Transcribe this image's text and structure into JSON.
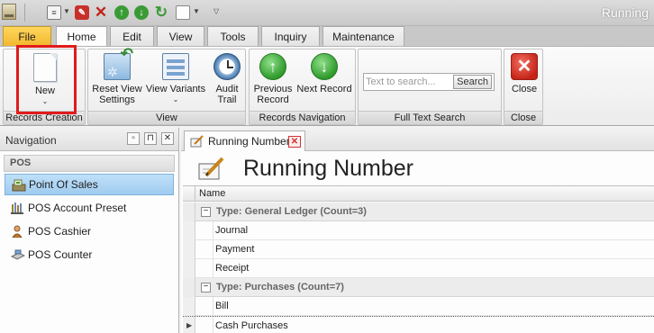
{
  "window": {
    "title": "Running"
  },
  "quick_access": [
    {
      "icon": "document-icon"
    },
    {
      "icon": "pdf-icon"
    },
    {
      "icon": "delete-icon"
    },
    {
      "icon": "move-up-icon"
    },
    {
      "icon": "move-down-icon"
    },
    {
      "icon": "refresh-icon"
    },
    {
      "icon": "new-page-icon"
    },
    {
      "icon": "customize-icon"
    }
  ],
  "ribbon": {
    "tabs": [
      "File",
      "Home",
      "Edit",
      "View",
      "Tools",
      "Inquiry",
      "Maintenance"
    ],
    "active_tab": "Home",
    "groups": {
      "records_creation": {
        "caption": "Records Creation",
        "new_label": "New"
      },
      "view": {
        "caption": "View",
        "reset_label": "Reset View\nSettings",
        "variants_label": "View Variants",
        "audit_label": "Audit\nTrail"
      },
      "navigation": {
        "caption": "Records Navigation",
        "previous_label": "Previous\nRecord",
        "next_label": "Next Record"
      },
      "search": {
        "caption": "Full Text Search",
        "placeholder": "Text to search...",
        "button_label": "Search"
      },
      "close": {
        "caption": "Close",
        "close_label": "Close"
      }
    }
  },
  "navigation": {
    "title": "Navigation",
    "section": "POS",
    "items": [
      {
        "label": "Point Of Sales",
        "icon": "point-of-sales-icon",
        "selected": true
      },
      {
        "label": "POS Account Preset",
        "icon": "account-preset-icon",
        "selected": false
      },
      {
        "label": "POS Cashier",
        "icon": "cashier-icon",
        "selected": false
      },
      {
        "label": "POS Counter",
        "icon": "counter-icon",
        "selected": false
      }
    ]
  },
  "document": {
    "tab_label": "Running Number",
    "title": "Running Number",
    "grid": {
      "column": "Name",
      "rows": [
        {
          "type": "group",
          "text": "Type: General Ledger (Count=3)"
        },
        {
          "type": "data",
          "text": "Journal"
        },
        {
          "type": "data",
          "text": "Payment"
        },
        {
          "type": "data",
          "text": "Receipt"
        },
        {
          "type": "group",
          "text": "Type: Purchases (Count=7)"
        },
        {
          "type": "data",
          "text": "Bill"
        },
        {
          "type": "data",
          "text": "Cash Purchases"
        }
      ]
    }
  },
  "colors": {
    "highlight": "#e01b1b",
    "file_tab": "#f2b82f",
    "selected_item": "#9fcbee"
  }
}
